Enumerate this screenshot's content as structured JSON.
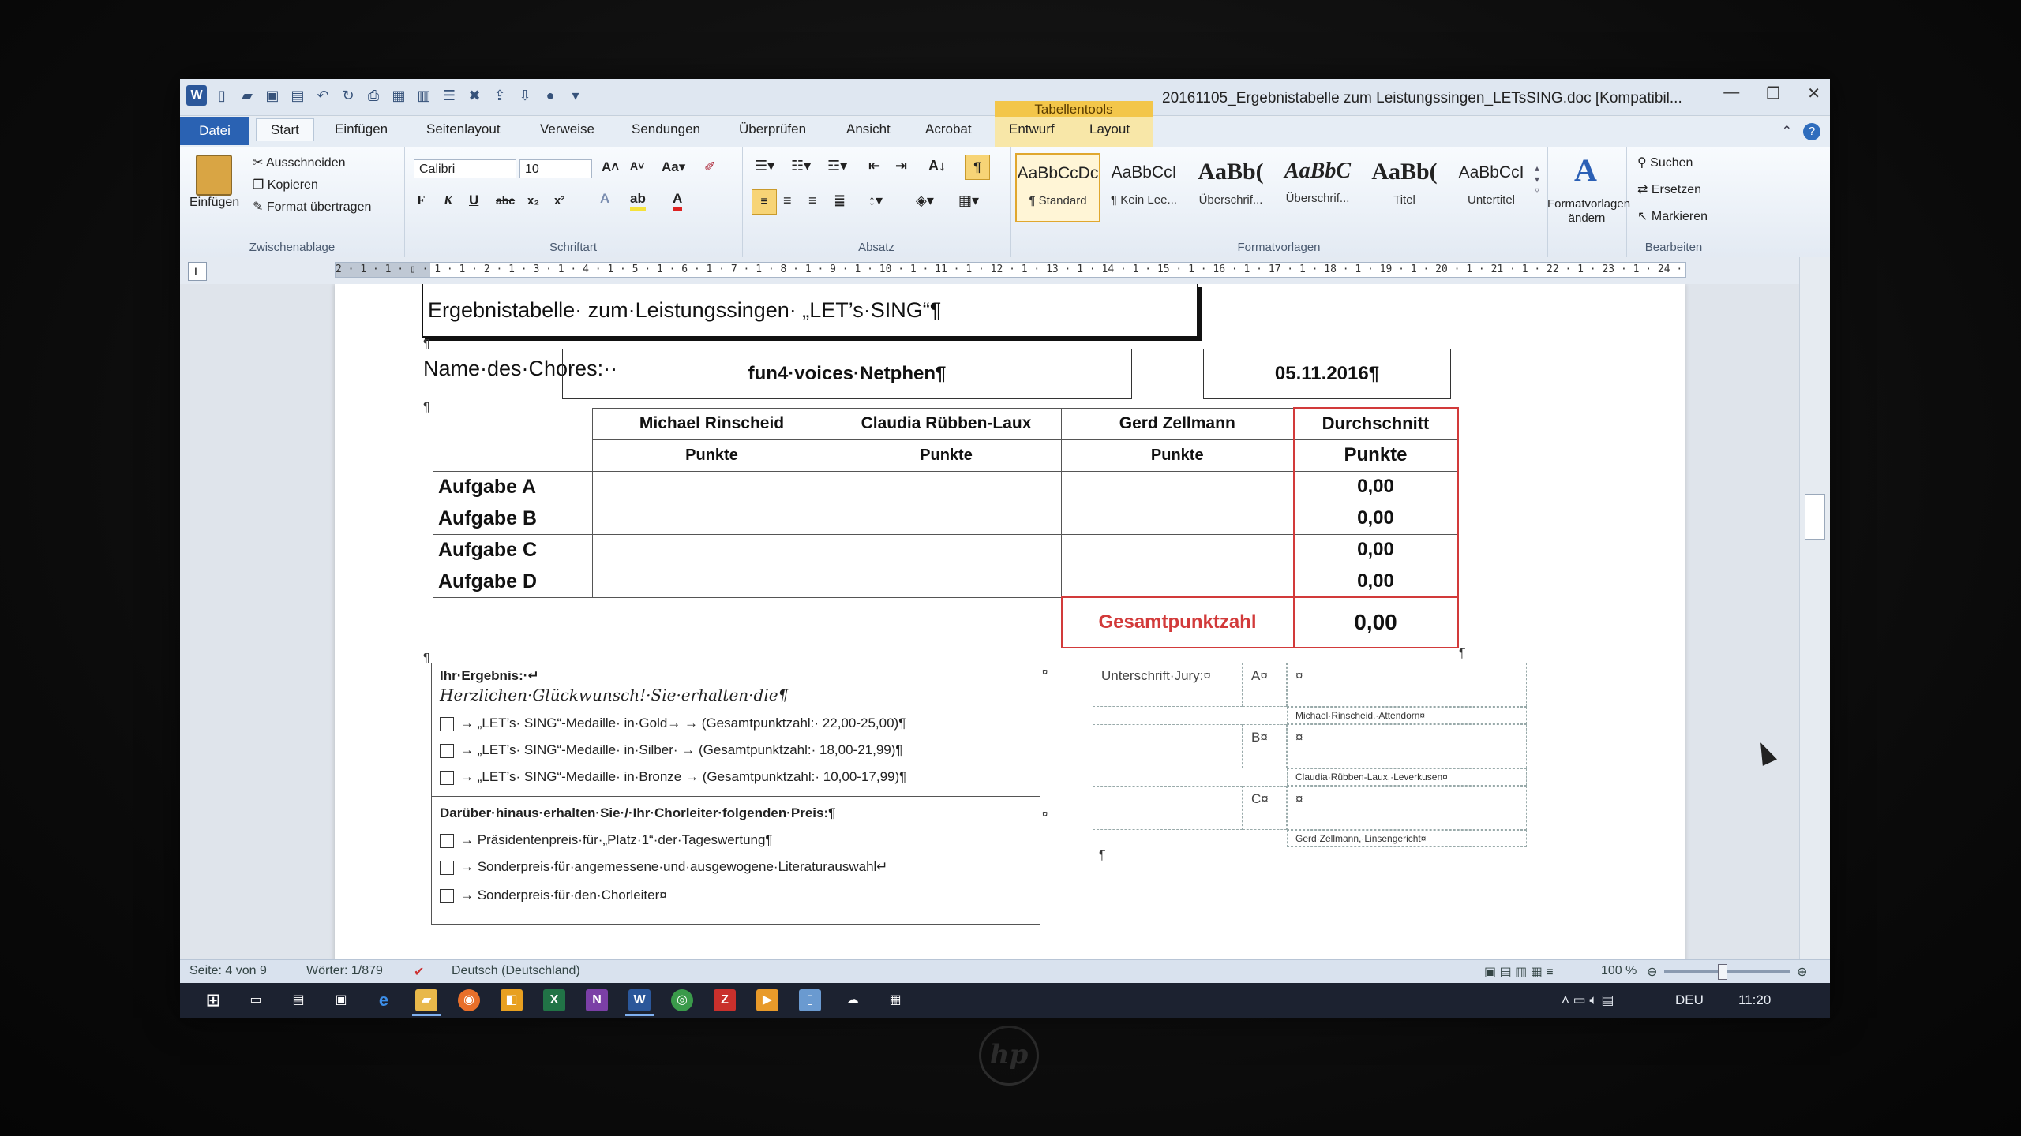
{
  "window": {
    "doc_title": "20161105_Ergebnistabelle zum Leistungssingen_LETsSING.doc [Kompatibil...",
    "context_tab_title": "Tabellentools"
  },
  "tabs": [
    "Datei",
    "Start",
    "Einfügen",
    "Seitenlayout",
    "Verweise",
    "Sendungen",
    "Überprüfen",
    "Ansicht",
    "Acrobat",
    "Entwurf",
    "Layout"
  ],
  "clipboard": {
    "paste": "Einfügen",
    "cut": "Ausschneiden",
    "copy": "Kopieren",
    "format_painter": "Format übertragen",
    "group_label": "Zwischenablage"
  },
  "font": {
    "name": "Calibri",
    "size": "10",
    "group_label": "Schriftart"
  },
  "paragraph": {
    "group_label": "Absatz"
  },
  "styles": {
    "items": [
      {
        "sample": "AaBbCcDc",
        "name": "¶ Standard"
      },
      {
        "sample": "AaBbCcI",
        "name": "¶ Kein Lee..."
      },
      {
        "sample": "AaBb(",
        "name": "Überschrif..."
      },
      {
        "sample": "AaBbC",
        "name": "Überschrif..."
      },
      {
        "sample": "AaBb(",
        "name": "Titel"
      },
      {
        "sample": "AaBbCcI",
        "name": "Untertitel"
      }
    ],
    "change_label_1": "Formatvorlagen",
    "change_label_2": "ändern",
    "group_label": "Formatvorlagen"
  },
  "editing": {
    "find": "Suchen",
    "replace": "Ersetzen",
    "select": "Markieren",
    "group_label": "Bearbeiten"
  },
  "ruler": {
    "ticks": "2 · 1 · 1 · ▯ · 1 · 1 · 2 · 1 · 3 · 1 · 4 · 1 · 5 · 1 · 6 · 1 · 7 · 1 · 8 · 1 · 9 · 1 · 10 · 1 · 11 · 1 · 12 · 1 · 13 · 1 · 14 · 1 · 15 · 1 · 16 · 1 · 17 · 1 · 18 · 1 · 19 · 1 · 20 · 1 · 21 · 1 · 22 · 1 · 23 · 1 · 24 · 1 · 25 · 1 · 26 · 1 · 27"
  },
  "document": {
    "heading": "Ergebnistabelle· zum·Leistungssingen· „LET’s·SING“¶",
    "choir_label": "Name·des·Chores:··",
    "choir_name": "fun4·voices·Netphen¶",
    "date": "05.11.2016¶",
    "judges": [
      "Michael Rinscheid",
      "Claudia Rübben-Laux",
      "Gerd Zellmann"
    ],
    "average_header": "Durchschnitt",
    "points_label": "Punkte",
    "tasks": [
      {
        "name": "Aufgabe A",
        "avg": "0,00"
      },
      {
        "name": "Aufgabe B",
        "avg": "0,00"
      },
      {
        "name": "Aufgabe C",
        "avg": "0,00"
      },
      {
        "name": "Aufgabe D",
        "avg": "0,00"
      }
    ],
    "total_label": "Gesamtpunktzahl",
    "total_value": "0,00",
    "result": {
      "label": "Ihr·Ergebnis:·↵",
      "congrats": "Herzlichen·Glückwunsch!·Sie·erhalten·die¶",
      "medals": [
        "→ „LET’s· SING“-Medaille· in·Gold→ → (Gesamtpunktzahl:· 22,00-25,00)¶",
        "→ „LET’s· SING“-Medaille· in·Silber· → (Gesamtpunktzahl:· 18,00-21,99)¶",
        "→ „LET’s· SING“-Medaille· in·Bronze → (Gesamtpunktzahl:· 10,00-17,99)¶"
      ],
      "extra_label": "Darüber·hinaus·erhalten·Sie·/·Ihr·Chorleiter·folgenden·Preis:¶",
      "prizes": [
        "→ Präsidentenpreis·für·„Platz·1“·der·Tageswertung¶",
        "→ Sonderpreis·für·angemessene·und·ausgewogene·Literaturauswahl↵",
        "→ Sonderpreis·für·den·Chorleiter¤"
      ]
    },
    "signature": {
      "label": "Unterschrift·Jury:¤",
      "rows": [
        {
          "letter": "A¤",
          "name": "Michael·Rinscheid,·Attendorn¤"
        },
        {
          "letter": "B¤",
          "name": "Claudia·Rübben-Laux,·Leverkusen¤"
        },
        {
          "letter": "C¤",
          "name": "Gerd·Zellmann,·Linsengericht¤"
        }
      ]
    }
  },
  "status": {
    "page": "Seite: 4 von 9",
    "words": "Wörter: 1/879",
    "language": "Deutsch (Deutschland)",
    "zoom": "100 %"
  },
  "tray": {
    "lang": "DEU",
    "time": "11:20"
  }
}
